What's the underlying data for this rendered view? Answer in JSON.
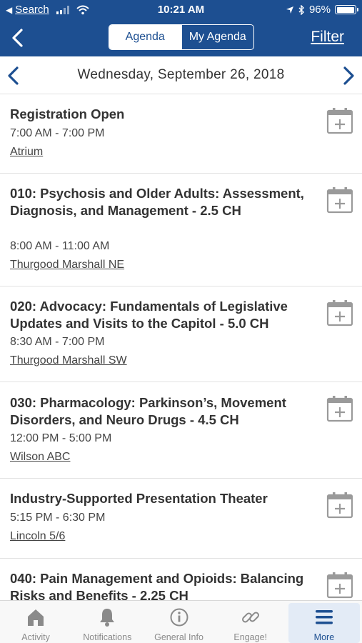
{
  "status_bar": {
    "back_app": "Search",
    "time": "10:21 AM",
    "battery": "96%",
    "battery_level": 0.96
  },
  "nav": {
    "segments": [
      "Agenda",
      "My Agenda"
    ],
    "active_segment": "Agenda",
    "filter_label": "Filter"
  },
  "date_header": {
    "date": "Wednesday, September 26, 2018"
  },
  "sessions": [
    {
      "title": "Registration Open",
      "time": "7:00 AM - 7:00 PM",
      "room": "Atrium"
    },
    {
      "title": "010: Psychosis and Older Adults: Assessment, Diagnosis, and Management - 2.5 CH",
      "time": "8:00 AM - 11:00 AM",
      "room": "Thurgood Marshall NE"
    },
    {
      "title": "020: Advocacy: Fundamentals of Legislative Updates and Visits to the Capitol - 5.0 CH",
      "time": "8:30 AM - 7:00 PM",
      "room": "Thurgood Marshall SW"
    },
    {
      "title": "030: Pharmacology: Parkinson’s, Movement Disorders, and Neuro Drugs - 4.5 CH",
      "time": "12:00 PM - 5:00 PM",
      "room": "Wilson ABC"
    },
    {
      "title": "Industry-Supported Presentation Theater",
      "time": "5:15 PM - 6:30 PM",
      "room": "Lincoln 5/6"
    },
    {
      "title": "040: Pain Management and Opioids: Balancing Risks and Benefits - 2.25 CH",
      "time": "",
      "room": ""
    }
  ],
  "tab_bar": {
    "items": [
      {
        "label": "Activity",
        "icon": "home-icon"
      },
      {
        "label": "Notifications",
        "icon": "bell-icon"
      },
      {
        "label": "General Info",
        "icon": "info-icon"
      },
      {
        "label": "Engage!",
        "icon": "link-icon"
      },
      {
        "label": "More",
        "icon": "menu-icon"
      }
    ],
    "active": "More"
  },
  "colors": {
    "brand_blue": "#1d4f91",
    "icon_gray": "#9a9a9a",
    "tab_active_bg": "#e3ebf6"
  }
}
